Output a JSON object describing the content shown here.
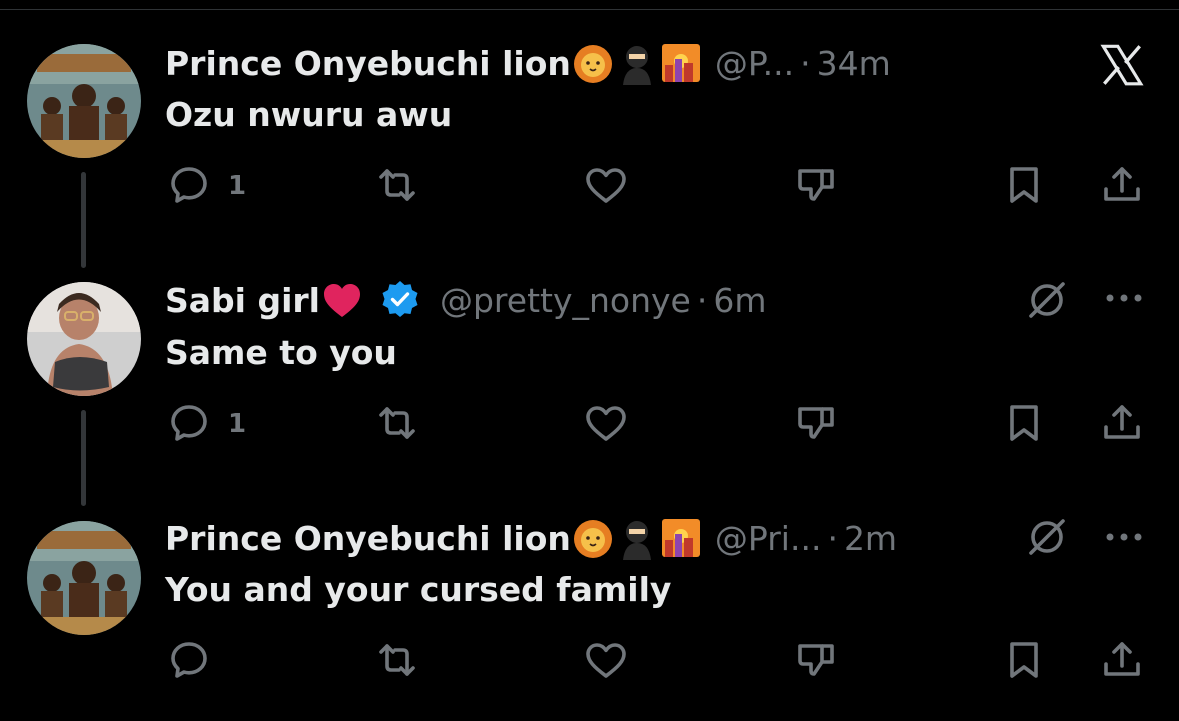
{
  "brand_logo": "x-logo",
  "colors": {
    "background": "#000000",
    "text": "#e7e9ea",
    "muted": "#71767b",
    "verified": "#1d9bf0",
    "heart": "#e0245e"
  },
  "tweets": [
    {
      "display_name": "Prince Onyebuchi lion",
      "name_emojis": [
        "lion-emoji",
        "ninja-emoji",
        "sunset-city-emoji"
      ],
      "handle": "@P...",
      "separator": "·",
      "time": "34m",
      "text": "Ozu nwuru awu",
      "reply_count": "1"
    },
    {
      "display_name": "Sabi girl",
      "name_emojis": [
        "red-heart-emoji"
      ],
      "verified": true,
      "handle": "@pretty_nonye",
      "separator": "·",
      "time": "6m",
      "text": "Same to you",
      "reply_count": "1"
    },
    {
      "display_name": "Prince Onyebuchi lion",
      "name_emojis": [
        "lion-emoji",
        "ninja-emoji",
        "sunset-city-emoji"
      ],
      "handle": "@Pri...",
      "separator": "·",
      "time": "2m",
      "text": "You and your cursed family",
      "reply_count": ""
    }
  ]
}
